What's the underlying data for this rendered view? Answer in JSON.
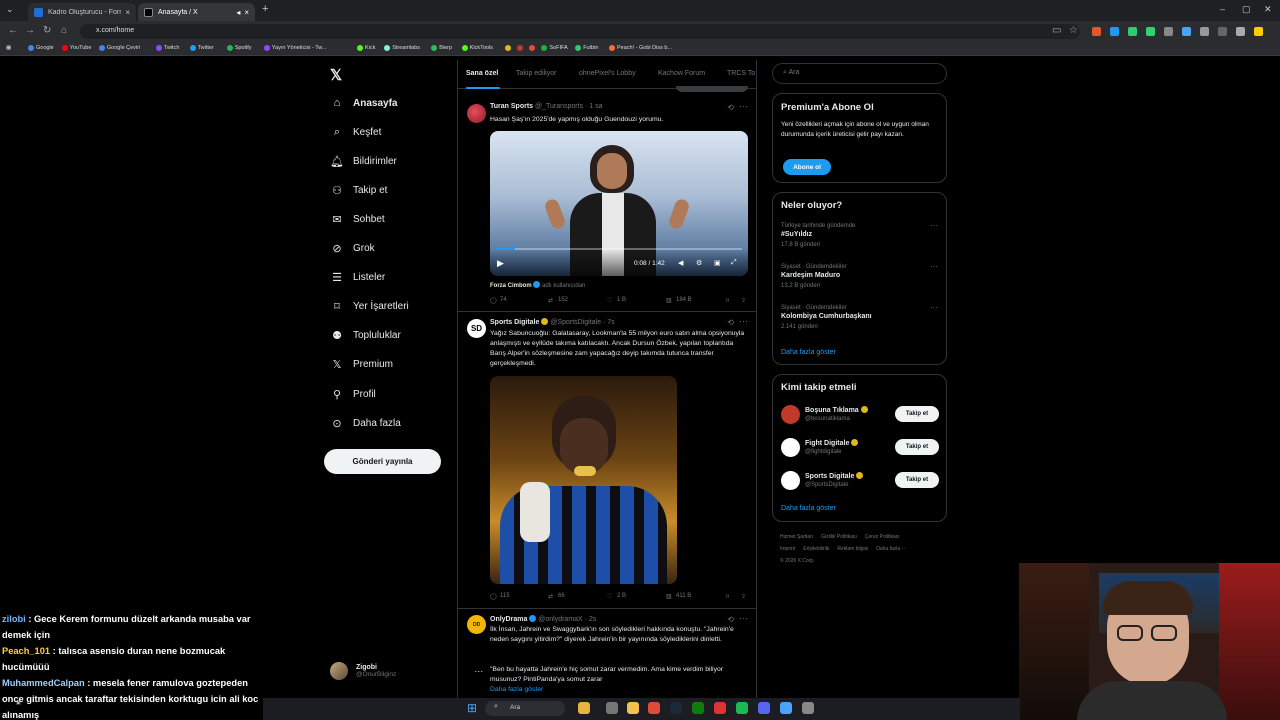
{
  "browser": {
    "tabs": [
      {
        "title": "Kadro Oluşturucu - Formasyon",
        "active": false
      },
      {
        "title": "Anasayfa / X",
        "active": true
      }
    ],
    "url": "x.com/home",
    "bookmarks": [
      "Google",
      "YouTube",
      "Google Çeviri",
      "Twitch",
      "Twitter",
      "Spotify",
      "Yayın Yöneticisi - Tw...",
      "Kick",
      "Streamlabs",
      "Bierp",
      "KickTools",
      "",
      "",
      "",
      "SoFIFA",
      "Futbin",
      "Peach! - Gobi Diss b..."
    ]
  },
  "nav": {
    "items": [
      {
        "label": "Anasayfa",
        "icon": "home-icon"
      },
      {
        "label": "Keşfet",
        "icon": "search-icon"
      },
      {
        "label": "Bildirimler",
        "icon": "bell-icon"
      },
      {
        "label": "Takip et",
        "icon": "person-add-icon"
      },
      {
        "label": "Sohbet",
        "icon": "mail-icon"
      },
      {
        "label": "Grok",
        "icon": "grok-icon"
      },
      {
        "label": "Listeler",
        "icon": "list-icon"
      },
      {
        "label": "Yer İşaretleri",
        "icon": "bookmark-icon"
      },
      {
        "label": "Topluluklar",
        "icon": "communities-icon"
      },
      {
        "label": "Premium",
        "icon": "x-logo-icon"
      },
      {
        "label": "Profil",
        "icon": "person-icon"
      },
      {
        "label": "Daha fazla",
        "icon": "more-circle-icon"
      }
    ],
    "post_button": "Gönderi yayınla",
    "account": {
      "name": "Zigobi",
      "handle": "@OnurBilginz"
    }
  },
  "feed": {
    "tabs": [
      "Sana özel",
      "Takip ediliyor",
      "ohnePixel's Lobby",
      "Kachow Forum",
      "TRCS To"
    ],
    "tweets": [
      {
        "name": "Turan Sports",
        "handle": "@_Turansports",
        "time": "1 sa",
        "text": "Hasan Şaş'ın 2025'de yapmış olduğu Guendouzi yorumu.",
        "video_time": "0:08 / 1:42",
        "from": "Forza Cimbom",
        "from_suffix": "adlı kullanıcıdan",
        "replies": "74",
        "reposts": "152",
        "likes": "1 B",
        "views": "184 B"
      },
      {
        "name": "Sports Digitale",
        "handle": "@SportsDigitale",
        "time": "7s",
        "text": "Yağız Sabuncuoğlu: Galatasaray, Lookman'la 55 milyon euro satın alma opsiyonuyla anlaşmıştı ve eyllüde takıma katılacaktı. Ancak Dursun Özbek, yapılan toplantıda Barış Alper'in sözleşmesine zam yapacağız deyip takımda tutunca transfer gerçekleşmedi.",
        "replies": "115",
        "reposts": "66",
        "likes": "2 B",
        "views": "411 B"
      },
      {
        "name": "OnlyDrama",
        "handle": "@onlydramaX",
        "time": "2s",
        "text": "İlk İnsan, Jahrein ve Swaggybark'ın son söyledikleri hakkında konuştu. \"Jahrein'e neden saygını yitirdim?\" diyerek Jahrein'in bir yayınında söylediklerini dinletti.",
        "text2": "\"Ben bu hayatta Jahrein'e hiç somut zarar vermedim. Ama kime verdim biliyor musunuz? PintiPanda'ya somut zarar",
        "show_more": "Daha fazla göster"
      }
    ]
  },
  "right": {
    "search_placeholder": "Ara",
    "premium": {
      "title": "Premium'a Abone Ol",
      "text": "Yeni özellikleri açmak için abone ol ve uygun olman durumunda içerik üreticisi gelir payı kazan.",
      "button": "Abone ol"
    },
    "trends_title": "Neler oluyor?",
    "trends": [
      {
        "context": "Türkiye tarihinde gündemde",
        "topic": "#SuYıldız",
        "count": "17,8 B gönderi"
      },
      {
        "context": "Siyaset · Gündemdekiler",
        "topic": "Kardeşim Maduro",
        "count": "13,2 B gönderi"
      },
      {
        "context": "Siyaset · Gündemdekiler",
        "topic": "Kolombiya Cumhurbaşkanı",
        "count": "2.141 gönderi"
      }
    ],
    "show_more": "Daha fazla göster",
    "who_title": "Kimi takip etmeli",
    "who": [
      {
        "name": "Boşuna Tıklama",
        "handle": "@bosunatiklama",
        "button": "Takip et"
      },
      {
        "name": "Fight Digitale",
        "handle": "@fightdigitale",
        "button": "Takip et"
      },
      {
        "name": "Sports Digitale",
        "handle": "@SportsDigitale",
        "button": "Takip et"
      }
    ],
    "footer": [
      "Hizmet Şartları",
      "Gizlilik Politikası",
      "Çerez Politikası",
      "Imprint",
      "Erişilebilirlik",
      "Reklam bilgisi",
      "Daha fazla ···",
      "© 2026 X Corp."
    ]
  },
  "chat": [
    {
      "user": "zilobi",
      "color": "#6fb6ff",
      "msg": "Gece Kerem formunu düzelt arkanda musaba var demek için"
    },
    {
      "user": "Peach_101",
      "color": "#ffd23f",
      "msg": "talısca asensio duran nene bozmucak hucümüüü"
    },
    {
      "user": "MuhammedCalpan",
      "color": "#9ad1ff",
      "msg": "mesela fener ramulova goztepeden once gitmis ancak taraftar tekisinden korktugu icin ali koc alınamış"
    }
  ],
  "taskbar": {
    "search": "Ara"
  }
}
